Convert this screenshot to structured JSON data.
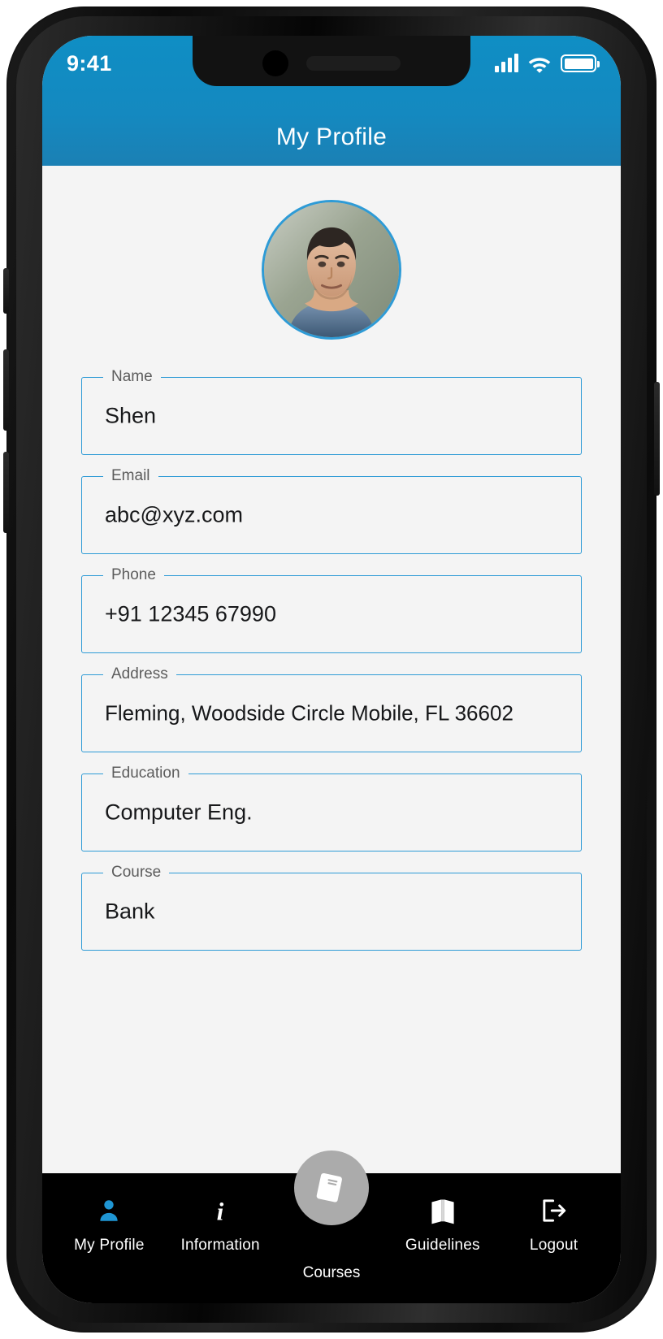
{
  "status_bar": {
    "time": "9:41",
    "icons": [
      "signal-bars-icon",
      "wifi-icon",
      "battery-icon"
    ]
  },
  "header": {
    "title": "My Profile",
    "background_color": "#1389c0"
  },
  "theme": {
    "accent": "#2e9bd6",
    "screen_background": "#f4f4f4",
    "nav_background": "#000000",
    "fab_background": "#ababab"
  },
  "profile": {
    "avatar": "user-photo",
    "avatar_border_color": "#2e9bd6"
  },
  "fields": [
    {
      "label": "Name",
      "value": "Shen"
    },
    {
      "label": "Email",
      "value": "abc@xyz.com"
    },
    {
      "label": "Phone",
      "value": "+91 12345 67990"
    },
    {
      "label": "Address",
      "value": "Fleming, Woodside Circle Mobile, FL 36602"
    },
    {
      "label": "Education",
      "value": "Computer Eng."
    },
    {
      "label": "Course",
      "value": "Bank"
    }
  ],
  "bottom_nav": {
    "items": [
      {
        "label": "My Profile",
        "icon": "person-icon",
        "active": true
      },
      {
        "label": "Information",
        "icon": "info-icon",
        "active": false
      },
      {
        "label": "Courses",
        "icon": "book-icon",
        "active": false
      },
      {
        "label": "Guidelines",
        "icon": "open-book-icon",
        "active": false
      },
      {
        "label": "Logout",
        "icon": "logout-arrow-icon",
        "active": false
      }
    ]
  }
}
